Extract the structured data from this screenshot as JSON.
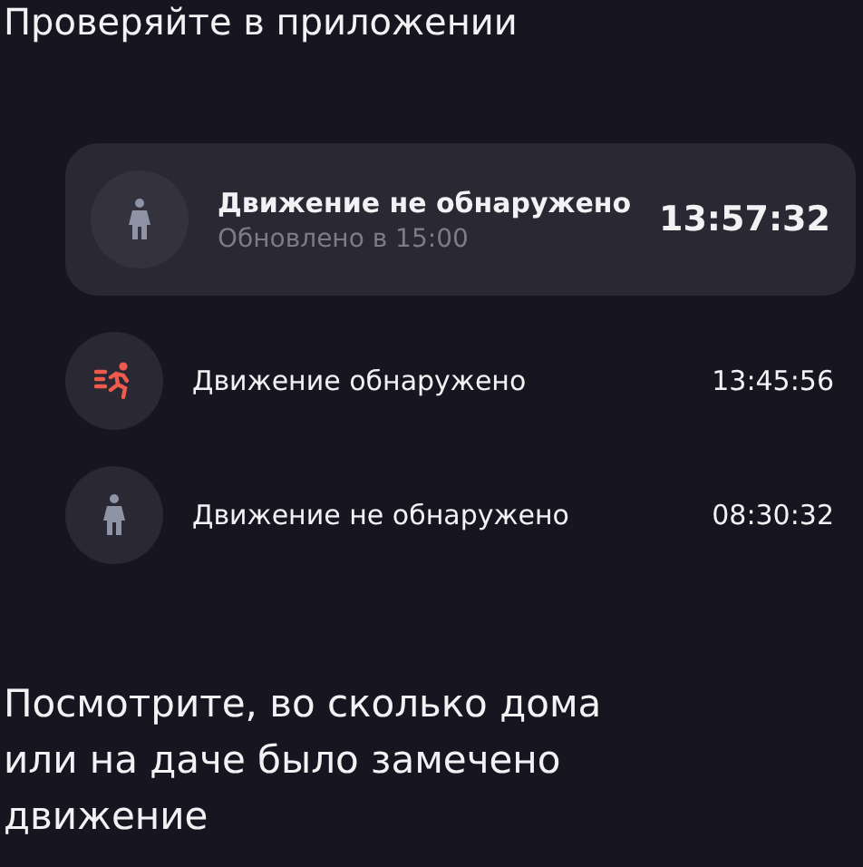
{
  "title": "Проверяйте в приложении",
  "events": [
    {
      "kind": "none",
      "label": "Движение не обнаружено",
      "time": "13:57:32",
      "subtitle": "Обновлено в 15:00",
      "selected": true
    },
    {
      "kind": "detected",
      "label": "Движение обнаружено",
      "time": "13:45:56",
      "selected": false
    },
    {
      "kind": "none",
      "label": "Движение не обнаружено",
      "time": "08:30:32",
      "selected": false
    }
  ],
  "caption": "Посмотрите, во сколько дома или на даче было замечено движение"
}
